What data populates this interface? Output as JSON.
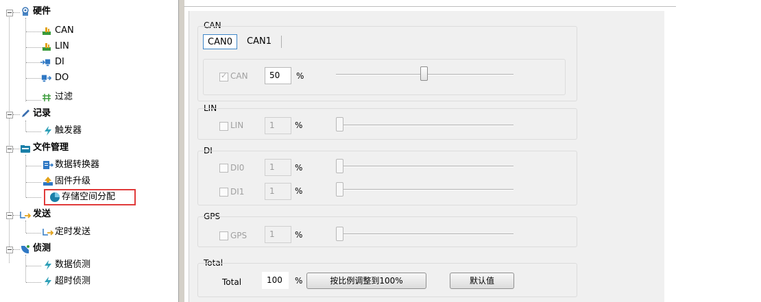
{
  "tree": {
    "groups": [
      {
        "label": "硬件",
        "icon": "hardware-icon",
        "children": [
          {
            "label": "CAN",
            "icon": "can-icon"
          },
          {
            "label": "LIN",
            "icon": "lin-icon"
          },
          {
            "label": "DI",
            "icon": "digital-input-icon"
          },
          {
            "label": "DO",
            "icon": "digital-output-icon"
          },
          {
            "label": "过滤",
            "icon": "filter-icon"
          }
        ]
      },
      {
        "label": "记录",
        "icon": "pencil-icon",
        "children": [
          {
            "label": "触发器",
            "icon": "lightning-icon"
          }
        ]
      },
      {
        "label": "文件管理",
        "icon": "folder-icon",
        "children": [
          {
            "label": "数据转换器",
            "icon": "converter-icon"
          },
          {
            "label": "固件升级",
            "icon": "upload-icon"
          },
          {
            "label": "存储空间分配",
            "icon": "pie-chart-icon"
          }
        ]
      },
      {
        "label": "发送",
        "icon": "send-icon",
        "children": [
          {
            "label": "定时发送",
            "icon": "timed-send-icon"
          }
        ]
      },
      {
        "label": "侦测",
        "icon": "detect-icon",
        "children": [
          {
            "label": "数据侦测",
            "icon": "lightning-icon"
          },
          {
            "label": "超时侦测",
            "icon": "lightning-icon"
          }
        ]
      }
    ],
    "selected": "存储空间分配"
  },
  "can": {
    "group_title": "CAN",
    "tabs": [
      "CAN0",
      "CAN1"
    ],
    "active_tab": "CAN0",
    "check_label": "CAN",
    "checked": true,
    "value": "50",
    "unit": "%",
    "slider_level": 0.5
  },
  "lin": {
    "group_title": "LIN",
    "check_label": "LIN",
    "checked": false,
    "value": "1",
    "unit": "%",
    "slider_level": 0.01
  },
  "di": {
    "group_title": "DI",
    "rows": [
      {
        "check_label": "DI0",
        "checked": false,
        "value": "1",
        "unit": "%",
        "slider_level": 0.01
      },
      {
        "check_label": "DI1",
        "checked": false,
        "value": "1",
        "unit": "%",
        "slider_level": 0.01
      }
    ]
  },
  "gps": {
    "group_title": "GPS",
    "check_label": "GPS",
    "checked": false,
    "value": "1",
    "unit": "%",
    "slider_level": 0.01
  },
  "total": {
    "group_title": "Total",
    "label": "Total",
    "value": "100",
    "unit": "%",
    "scale_button": "按比例调整到100%",
    "default_button": "默认值"
  },
  "colors": {
    "selection_outline": "#e03a3a",
    "active_tab_border": "#3d86c8",
    "panel_bg": "#f0f0f0"
  }
}
